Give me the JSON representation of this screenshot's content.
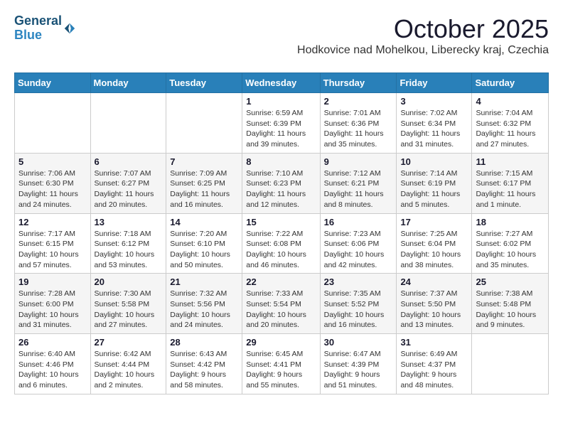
{
  "header": {
    "logo_line1": "General",
    "logo_line2": "Blue",
    "month_title": "October 2025",
    "subtitle": "Hodkovice nad Mohelkou, Liberecky kraj, Czechia"
  },
  "columns": [
    "Sunday",
    "Monday",
    "Tuesday",
    "Wednesday",
    "Thursday",
    "Friday",
    "Saturday"
  ],
  "weeks": [
    [
      {
        "day": "",
        "info": ""
      },
      {
        "day": "",
        "info": ""
      },
      {
        "day": "",
        "info": ""
      },
      {
        "day": "1",
        "info": "Sunrise: 6:59 AM\nSunset: 6:39 PM\nDaylight: 11 hours\nand 39 minutes."
      },
      {
        "day": "2",
        "info": "Sunrise: 7:01 AM\nSunset: 6:36 PM\nDaylight: 11 hours\nand 35 minutes."
      },
      {
        "day": "3",
        "info": "Sunrise: 7:02 AM\nSunset: 6:34 PM\nDaylight: 11 hours\nand 31 minutes."
      },
      {
        "day": "4",
        "info": "Sunrise: 7:04 AM\nSunset: 6:32 PM\nDaylight: 11 hours\nand 27 minutes."
      }
    ],
    [
      {
        "day": "5",
        "info": "Sunrise: 7:06 AM\nSunset: 6:30 PM\nDaylight: 11 hours\nand 24 minutes."
      },
      {
        "day": "6",
        "info": "Sunrise: 7:07 AM\nSunset: 6:27 PM\nDaylight: 11 hours\nand 20 minutes."
      },
      {
        "day": "7",
        "info": "Sunrise: 7:09 AM\nSunset: 6:25 PM\nDaylight: 11 hours\nand 16 minutes."
      },
      {
        "day": "8",
        "info": "Sunrise: 7:10 AM\nSunset: 6:23 PM\nDaylight: 11 hours\nand 12 minutes."
      },
      {
        "day": "9",
        "info": "Sunrise: 7:12 AM\nSunset: 6:21 PM\nDaylight: 11 hours\nand 8 minutes."
      },
      {
        "day": "10",
        "info": "Sunrise: 7:14 AM\nSunset: 6:19 PM\nDaylight: 11 hours\nand 5 minutes."
      },
      {
        "day": "11",
        "info": "Sunrise: 7:15 AM\nSunset: 6:17 PM\nDaylight: 11 hours\nand 1 minute."
      }
    ],
    [
      {
        "day": "12",
        "info": "Sunrise: 7:17 AM\nSunset: 6:15 PM\nDaylight: 10 hours\nand 57 minutes."
      },
      {
        "day": "13",
        "info": "Sunrise: 7:18 AM\nSunset: 6:12 PM\nDaylight: 10 hours\nand 53 minutes."
      },
      {
        "day": "14",
        "info": "Sunrise: 7:20 AM\nSunset: 6:10 PM\nDaylight: 10 hours\nand 50 minutes."
      },
      {
        "day": "15",
        "info": "Sunrise: 7:22 AM\nSunset: 6:08 PM\nDaylight: 10 hours\nand 46 minutes."
      },
      {
        "day": "16",
        "info": "Sunrise: 7:23 AM\nSunset: 6:06 PM\nDaylight: 10 hours\nand 42 minutes."
      },
      {
        "day": "17",
        "info": "Sunrise: 7:25 AM\nSunset: 6:04 PM\nDaylight: 10 hours\nand 38 minutes."
      },
      {
        "day": "18",
        "info": "Sunrise: 7:27 AM\nSunset: 6:02 PM\nDaylight: 10 hours\nand 35 minutes."
      }
    ],
    [
      {
        "day": "19",
        "info": "Sunrise: 7:28 AM\nSunset: 6:00 PM\nDaylight: 10 hours\nand 31 minutes."
      },
      {
        "day": "20",
        "info": "Sunrise: 7:30 AM\nSunset: 5:58 PM\nDaylight: 10 hours\nand 27 minutes."
      },
      {
        "day": "21",
        "info": "Sunrise: 7:32 AM\nSunset: 5:56 PM\nDaylight: 10 hours\nand 24 minutes."
      },
      {
        "day": "22",
        "info": "Sunrise: 7:33 AM\nSunset: 5:54 PM\nDaylight: 10 hours\nand 20 minutes."
      },
      {
        "day": "23",
        "info": "Sunrise: 7:35 AM\nSunset: 5:52 PM\nDaylight: 10 hours\nand 16 minutes."
      },
      {
        "day": "24",
        "info": "Sunrise: 7:37 AM\nSunset: 5:50 PM\nDaylight: 10 hours\nand 13 minutes."
      },
      {
        "day": "25",
        "info": "Sunrise: 7:38 AM\nSunset: 5:48 PM\nDaylight: 10 hours\nand 9 minutes."
      }
    ],
    [
      {
        "day": "26",
        "info": "Sunrise: 6:40 AM\nSunset: 4:46 PM\nDaylight: 10 hours\nand 6 minutes."
      },
      {
        "day": "27",
        "info": "Sunrise: 6:42 AM\nSunset: 4:44 PM\nDaylight: 10 hours\nand 2 minutes."
      },
      {
        "day": "28",
        "info": "Sunrise: 6:43 AM\nSunset: 4:42 PM\nDaylight: 9 hours\nand 58 minutes."
      },
      {
        "day": "29",
        "info": "Sunrise: 6:45 AM\nSunset: 4:41 PM\nDaylight: 9 hours\nand 55 minutes."
      },
      {
        "day": "30",
        "info": "Sunrise: 6:47 AM\nSunset: 4:39 PM\nDaylight: 9 hours\nand 51 minutes."
      },
      {
        "day": "31",
        "info": "Sunrise: 6:49 AM\nSunset: 4:37 PM\nDaylight: 9 hours\nand 48 minutes."
      },
      {
        "day": "",
        "info": ""
      }
    ]
  ]
}
